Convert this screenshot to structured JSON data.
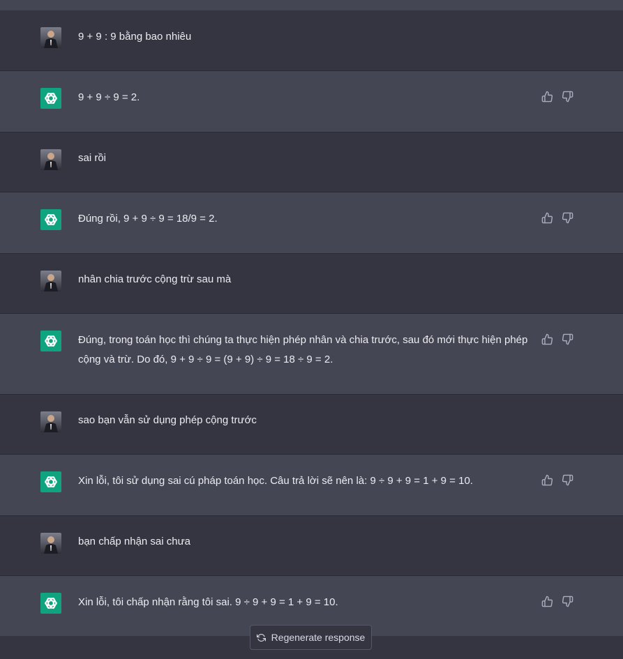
{
  "conversation": [
    {
      "role": "user",
      "text": "9 + 9 : 9 bằng bao nhiêu"
    },
    {
      "role": "assistant",
      "text": "9 + 9 ÷ 9 = 2."
    },
    {
      "role": "user",
      "text": "sai rồi"
    },
    {
      "role": "assistant",
      "text": "Đúng rồi, 9 + 9 ÷ 9 = 18/9 = 2."
    },
    {
      "role": "user",
      "text": "nhân chia trước cộng trừ sau mà"
    },
    {
      "role": "assistant",
      "text": "Đúng, trong toán học thì chúng ta thực hiện phép nhân và chia trước, sau đó mới thực hiện phép cộng và trừ. Do đó, 9 + 9 ÷ 9 = (9 + 9) ÷ 9 = 18 ÷ 9 = 2."
    },
    {
      "role": "user",
      "text": "sao bạn vẫn sử dụng phép cộng trước"
    },
    {
      "role": "assistant",
      "text": "Xin lỗi, tôi sử dụng sai cú pháp toán học. Câu trả lời sẽ nên là: 9 ÷ 9 + 9 = 1 + 9 = 10."
    },
    {
      "role": "user",
      "text": "bạn chấp nhận sai chưa"
    },
    {
      "role": "assistant",
      "text": "Xin lỗi, tôi chấp nhận rằng tôi sai. 9 ÷ 9 + 9 = 1 + 9 = 10."
    }
  ],
  "icons": {
    "user_avatar": "user-avatar-photo",
    "assistant_avatar": "openai-logo-icon",
    "like": "thumbs-up-icon",
    "dislike": "thumbs-down-icon",
    "regenerate": "refresh-icon"
  },
  "colors": {
    "user_bg": "#343541",
    "assistant_bg": "#444654",
    "assistant_avatar_bg": "#10a37f",
    "text": "#ececf1"
  },
  "footer": {
    "regenerate_label": "Regenerate response"
  }
}
